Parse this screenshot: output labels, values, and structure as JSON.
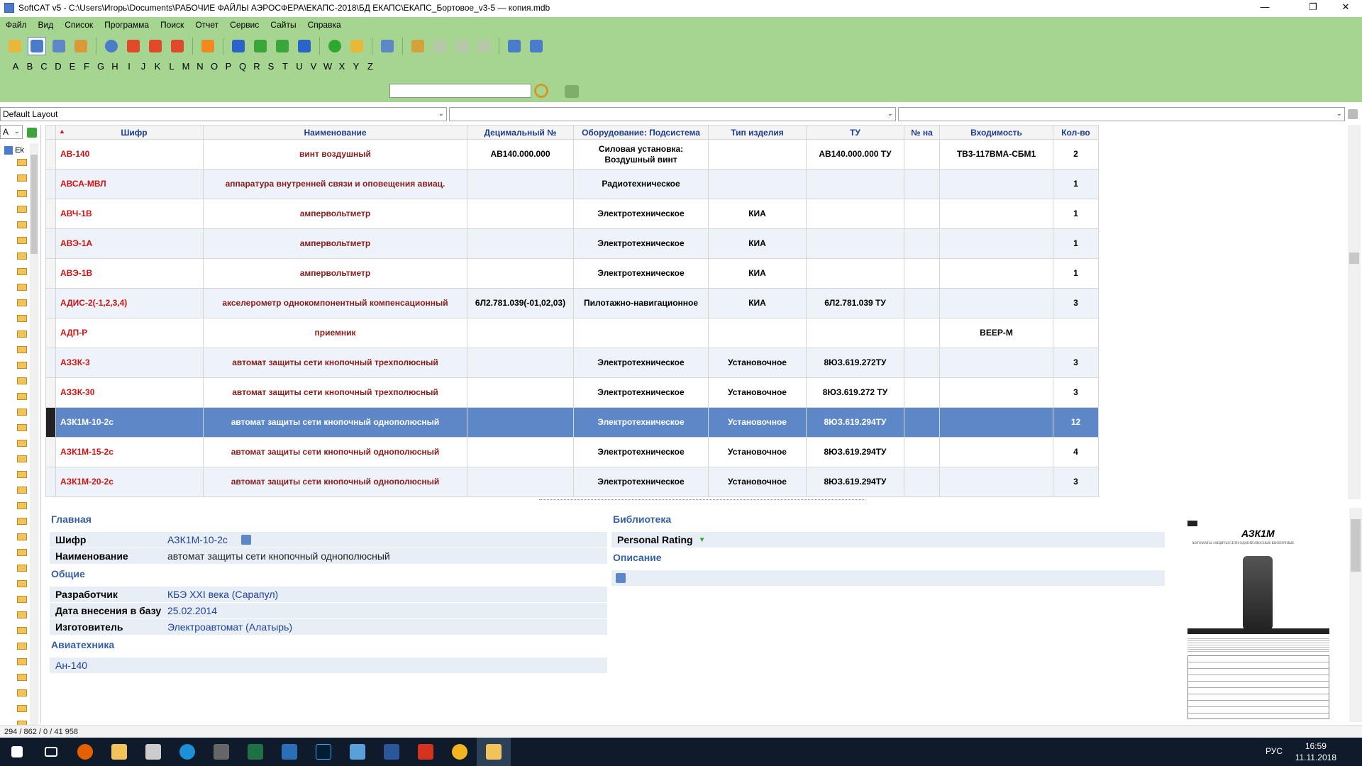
{
  "window": {
    "title": "SoftCAT v5 - C:\\Users\\Игорь\\Documents\\РАБОЧИЕ ФАЙЛЫ АЭРОСФЕРА\\ЕКАПС-2018\\БД ЕКАПС\\ЕКАПС_Бортовое_v3-5 — копия.mdb",
    "minimize": "—",
    "maximize": "❐",
    "close": "✕"
  },
  "menu": [
    "Файл",
    "Вид",
    "Список",
    "Программа",
    "Поиск",
    "Отчет",
    "Сервис",
    "Сайты",
    "Справка"
  ],
  "alphabet": [
    "A",
    "B",
    "C",
    "D",
    "E",
    "F",
    "G",
    "H",
    "I",
    "J",
    "K",
    "L",
    "M",
    "N",
    "O",
    "P",
    "Q",
    "R",
    "S",
    "T",
    "U",
    "V",
    "W",
    "X",
    "Y",
    "Z"
  ],
  "search": {
    "value": "",
    "placeholder": ""
  },
  "layout": {
    "selected": "Default Layout",
    "combo2": "",
    "combo3": ""
  },
  "left": {
    "letter": "A",
    "tree_root": "Ek"
  },
  "grid": {
    "columns": [
      "Шифр",
      "Наименование",
      "Децимальный №",
      "Оборудование: Подсистема",
      "Тип изделия",
      "ТУ",
      "№ на",
      "Входимость",
      "Кол-во"
    ],
    "rows": [
      {
        "code": "АВ-140",
        "name": "винт воздушный",
        "dec": "АВ140.000.000",
        "equip": "Силовая установка: Воздушный винт",
        "type": "",
        "tu": "АВ140.000.000 ТУ",
        "no": "",
        "entry": "ТВ3-117ВМА-СБМ1",
        "qty": "2"
      },
      {
        "code": "АВСА-МВЛ",
        "name": "аппаратура внутренней связи и оповещения авиац.",
        "dec": "",
        "equip": "Радиотехническое",
        "type": "",
        "tu": "",
        "no": "",
        "entry": "",
        "qty": "1"
      },
      {
        "code": "АВЧ-1В",
        "name": "ампервольтметр",
        "dec": "",
        "equip": "Электротехническое",
        "type": "КИА",
        "tu": "",
        "no": "",
        "entry": "",
        "qty": "1"
      },
      {
        "code": "АВЭ-1А",
        "name": "ампервольтметр",
        "dec": "",
        "equip": "Электротехническое",
        "type": "КИА",
        "tu": "",
        "no": "",
        "entry": "",
        "qty": "1"
      },
      {
        "code": "АВЭ-1В",
        "name": "ампервольтметр",
        "dec": "",
        "equip": "Электротехническое",
        "type": "КИА",
        "tu": "",
        "no": "",
        "entry": "",
        "qty": "1"
      },
      {
        "code": "АДИС-2(-1,2,3,4)",
        "name": "акселерометр однокомпонентный компенсационный",
        "dec": "6Л2.781.039(-01,02,03)",
        "equip": "Пилотажно-навигационное",
        "type": "КИА",
        "tu": "6Л2.781.039 ТУ",
        "no": "",
        "entry": "",
        "qty": "3"
      },
      {
        "code": "АДП-Р",
        "name": "приемник",
        "dec": "",
        "equip": "",
        "type": "",
        "tu": "",
        "no": "",
        "entry": "ВЕЕР-М",
        "qty": ""
      },
      {
        "code": "АЗЗК-3",
        "name": "автомат защиты сети кнопочный трехполюсный",
        "dec": "",
        "equip": "Электротехническое",
        "type": "Установочное",
        "tu": "8ЮЗ.619.272ТУ",
        "no": "",
        "entry": "",
        "qty": "3"
      },
      {
        "code": "АЗЗК-30",
        "name": "автомат защиты сети кнопочный трехполюсный",
        "dec": "",
        "equip": "Электротехническое",
        "type": "Установочное",
        "tu": "8ЮЗ.619.272 ТУ",
        "no": "",
        "entry": "",
        "qty": "3"
      },
      {
        "code": "АЗК1М-10-2с",
        "name": "автомат защиты сети кнопочный однополюсный",
        "dec": "",
        "equip": "Электротехническое",
        "type": "Установочное",
        "tu": "8ЮЗ.619.294ТУ",
        "no": "",
        "entry": "",
        "qty": "12"
      },
      {
        "code": "АЗК1М-15-2с",
        "name": "автомат защиты сети кнопочный однополюсный",
        "dec": "",
        "equip": "Электротехническое",
        "type": "Установочное",
        "tu": "8ЮЗ.619.294ТУ",
        "no": "",
        "entry": "",
        "qty": "4"
      },
      {
        "code": "АЗК1М-20-2с",
        "name": "автомат защиты сети кнопочный однополюсный",
        "dec": "",
        "equip": "Электротехническое",
        "type": "Установочное",
        "tu": "8ЮЗ.619.294ТУ",
        "no": "",
        "entry": "",
        "qty": "3"
      }
    ]
  },
  "detail": {
    "main_title": "Главная",
    "code_label": "Шифр",
    "code_value": "АЗК1М-10-2с",
    "name_label": "Наименование",
    "name_value": "автомат защиты сети кнопочный однополюсный",
    "general_title": "Общие",
    "dev_label": "Разработчик",
    "dev_value": "КБЭ XXI века (Сарапул)",
    "date_label": "Дата внесения в базу",
    "date_value": "25.02.2014",
    "maker_label": "Изготовитель",
    "maker_value": "Электроавтомат (Алатырь)",
    "avia_title": "Авиатехника",
    "avia_value": "Ан-140",
    "library_title": "Библиотека",
    "rating_label": "Personal Rating",
    "desc_title": "Описание",
    "doc_heading": "АЗК1М",
    "doc_sub": "АВТОМАТЫ ЗАЩИТЫ СЕТИ ОДНОПОЛЮСНЫЕ КНОПОЧНЫЕ"
  },
  "status": "294 / 862 / 0 / 41 958",
  "taskbar": {
    "lang": "РУС",
    "time": "16:59",
    "date": "11.11.2018"
  },
  "colors": {
    "toolbar": "#a6d592",
    "selected_row": "#5d87c6",
    "code_text": "#d01212",
    "header_text": "#1c3d8e"
  }
}
